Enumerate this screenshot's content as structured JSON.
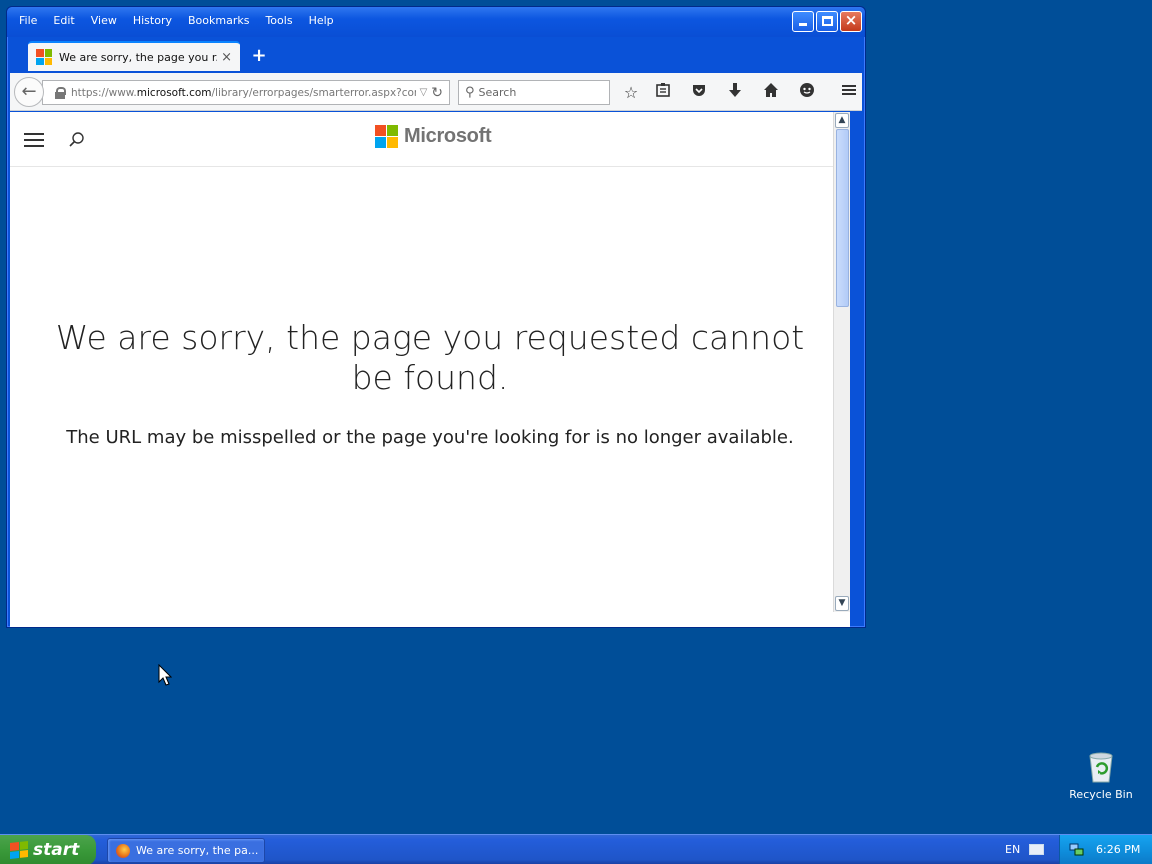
{
  "browser": {
    "menu": [
      "File",
      "Edit",
      "View",
      "History",
      "Bookmarks",
      "Tools",
      "Help"
    ],
    "tab": {
      "title": "We are sorry, the page you r...",
      "close": "×",
      "new_tab": "+"
    },
    "url": {
      "prefix": "https://www.",
      "domain": "microsoft.com",
      "path": "/library/errorpages/smarterror.aspx?correla"
    },
    "search": {
      "placeholder": "Search"
    },
    "toolbar_icons": [
      "star-icon",
      "reading-list-icon",
      "pocket-icon",
      "download-icon",
      "home-icon",
      "chat-icon",
      "menu-icon"
    ]
  },
  "page": {
    "brand": "Microsoft",
    "error_title": "We are sorry, the page you requested cannot be found.",
    "error_subtitle": "The URL may be misspelled or the page you're looking for is no longer available."
  },
  "desktop": {
    "recycle_bin_label": "Recycle Bin"
  },
  "taskbar": {
    "start_label": "start",
    "task_item_label": "We are sorry, the pa...",
    "language": "EN",
    "clock": "6:26 PM"
  },
  "colors": {
    "desktop": "#004e98",
    "ms_red": "#f25022",
    "ms_green": "#7fba00",
    "ms_blue": "#00a4ef",
    "ms_yellow": "#ffb900"
  }
}
